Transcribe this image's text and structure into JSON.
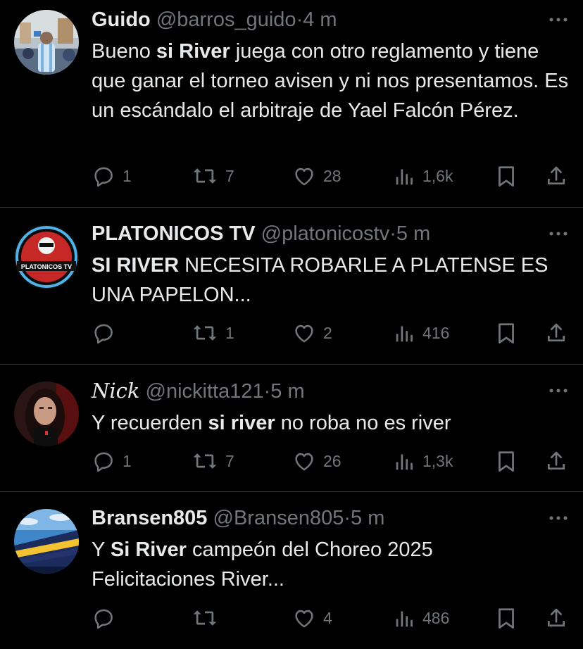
{
  "tweets": [
    {
      "name": "Guido",
      "handle": "@barros_guido",
      "separator": "·",
      "time": "4 m",
      "text_parts": [
        {
          "t": "Bueno ",
          "b": false
        },
        {
          "t": "si River",
          "b": true
        },
        {
          "t": " juega con otro reglamento y tiene que ganar el torneo avisen y ni nos presentamos. Es un escándalo el arbitraje de Yael Falcón Pérez.",
          "b": false
        }
      ],
      "replies": "1",
      "retweets": "7",
      "likes": "28",
      "views": "1,6k"
    },
    {
      "name": "PLATONICOS TV",
      "handle": "@platonicostv",
      "separator": "·",
      "time": "5 m",
      "avatar_text": "PLATONICOS TV",
      "text_parts": [
        {
          "t": "SI RIVER",
          "b": true
        },
        {
          "t": " NECESITA ROBARLE A PLATENSE ES UNA PAPELON...",
          "b": false
        }
      ],
      "replies": "",
      "retweets": "1",
      "likes": "2",
      "views": "416"
    },
    {
      "name": "Nick",
      "handle": "@nickitta121",
      "separator": "·",
      "time": "5 m",
      "text_parts": [
        {
          "t": "Y recuerden ",
          "b": false
        },
        {
          "t": "si river",
          "b": true
        },
        {
          "t": " no roba no es river",
          "b": false
        }
      ],
      "replies": "1",
      "retweets": "7",
      "likes": "26",
      "views": "1,3k"
    },
    {
      "name": "Bransen805",
      "handle": "@Bransen805",
      "separator": "·",
      "time": "5 m",
      "text_parts": [
        {
          "t": "Y ",
          "b": false
        },
        {
          "t": "Si River",
          "b": true
        },
        {
          "t": " campeón del Choreo 2025 Felicitaciones River...",
          "b": false
        }
      ],
      "replies": "",
      "retweets": "",
      "likes": "4",
      "views": "486"
    }
  ],
  "icons": {
    "reply": "reply-icon",
    "retweet": "retweet-icon",
    "like": "heart-icon",
    "views": "views-icon",
    "bookmark": "bookmark-icon",
    "share": "share-icon",
    "more": "more-icon"
  },
  "colors": {
    "background": "#000000",
    "text": "#e7e9ea",
    "muted": "#71767b",
    "divider": "#2f3336"
  }
}
